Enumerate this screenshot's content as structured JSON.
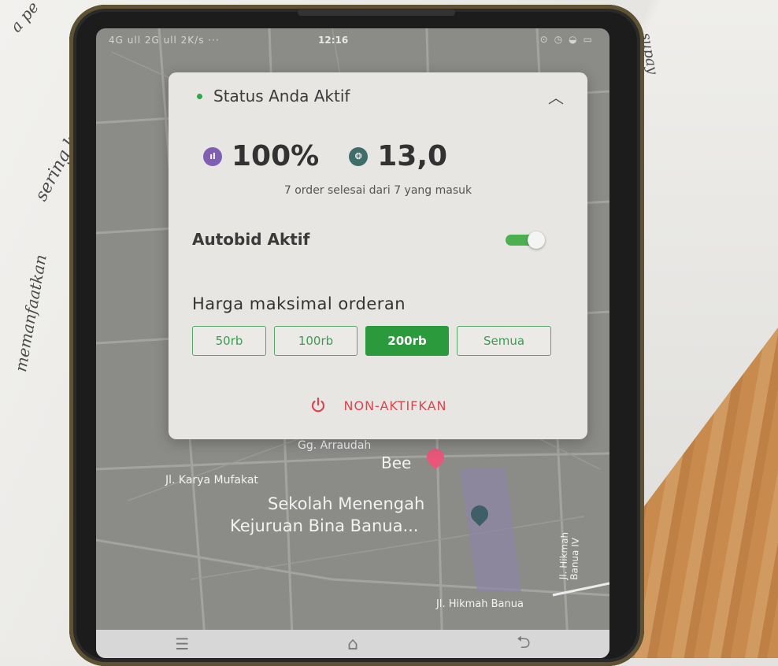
{
  "status_bar": {
    "signal_text": "4G ull 2G ull 2K/s ···",
    "time": "12:16",
    "icons": [
      "location-icon",
      "alarm-icon",
      "wifi-icon",
      "battery-icon"
    ]
  },
  "card": {
    "status_label": "Status Anda Aktif",
    "status_color": "#2aa84a",
    "collapse_icon": "chevron-up-icon",
    "metrics": [
      {
        "icon": "chart-icon",
        "icon_color": "#7f5fb3",
        "value": "100%"
      },
      {
        "icon": "medal-icon",
        "icon_color": "#3f6e6a",
        "value": "13,0"
      }
    ],
    "orders_info": "7 order selesai dari 7 yang masuk",
    "autobid": {
      "label": "Autobid Aktif",
      "enabled": true,
      "accent": "#4caf50"
    },
    "price": {
      "title": "Harga maksimal orderan",
      "options": [
        "50rb",
        "100rb",
        "200rb",
        "Semua"
      ],
      "selected": "200rb",
      "accent": "#2b9a3c"
    },
    "deactivate": {
      "icon": "power-icon",
      "label": "NON-AKTIFKAN",
      "color": "#d8474f"
    }
  },
  "map": {
    "labels": [
      "Gg. Arraudah",
      "Bee",
      "Jl. Karya Mufakat",
      "Sekolah Menengah",
      "Kejuruan Bina Banua...",
      "Jl. Hikmah Banua IV",
      "Jl. Hikmah Banua"
    ],
    "pins": [
      "restaurant-pin-icon",
      "school-pin-icon"
    ]
  },
  "nav": {
    "buttons": [
      "menu-icon",
      "home-icon",
      "back-icon"
    ]
  },
  "background": {
    "handwriting": [
      "sering ketem",
      "memanfaatkan",
      "a pe",
      "supay"
    ]
  }
}
